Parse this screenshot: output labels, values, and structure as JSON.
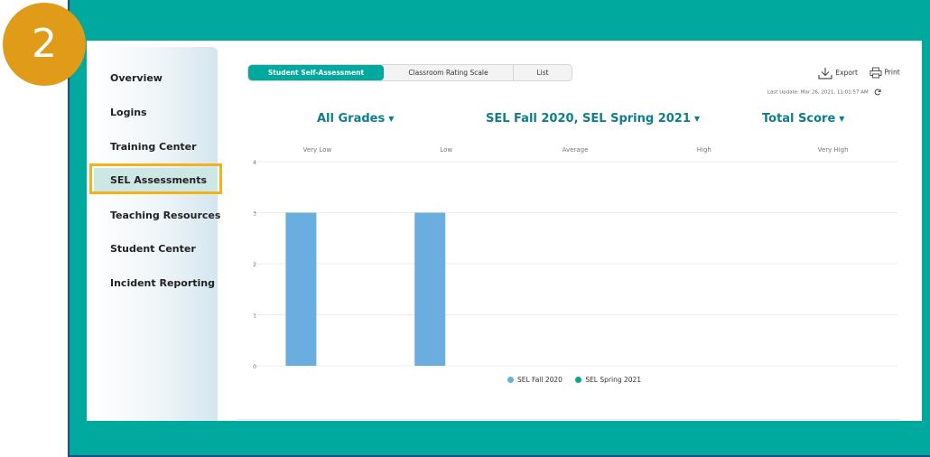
{
  "step_number": "2",
  "sidebar": {
    "items": [
      {
        "label": "Overview"
      },
      {
        "label": "Logins"
      },
      {
        "label": "Training Center"
      },
      {
        "label": "SEL Assessments"
      },
      {
        "label": "Teaching Resources"
      },
      {
        "label": "Student Center"
      },
      {
        "label": "Incident Reporting"
      }
    ],
    "active_index": 3
  },
  "tabs": [
    {
      "label": "Student Self-Assessment",
      "active": true
    },
    {
      "label": "Classroom Rating Scale",
      "active": false
    },
    {
      "label": "List",
      "active": false
    }
  ],
  "toolbar": {
    "export_label": "Export",
    "print_label": "Print",
    "last_update": "Last Update: Mar 26, 2021, 11:01:57 AM"
  },
  "filters": {
    "grades": "All Grades",
    "assessments": "SEL Fall 2020, SEL Spring 2021",
    "score": "Total Score"
  },
  "colors": {
    "teal": "#00a99d",
    "bar_fall": "#6aaee0",
    "bar_spring": "#00a99d",
    "badge": "#e09b18",
    "highlight": "#f2b318"
  },
  "chart_data": {
    "type": "bar",
    "categories": [
      "Very Low",
      "Low",
      "Average",
      "High",
      "Very High"
    ],
    "series": [
      {
        "name": "SEL Fall 2020",
        "values": [
          3,
          3,
          0,
          0,
          0
        ]
      },
      {
        "name": "SEL Spring 2021",
        "values": [
          0,
          0,
          0,
          0,
          0
        ]
      }
    ],
    "yticks": [
      "0",
      "1",
      "2",
      "3",
      "4"
    ],
    "ylim": [
      0,
      4
    ],
    "grid": true,
    "legend_position": "bottom"
  }
}
